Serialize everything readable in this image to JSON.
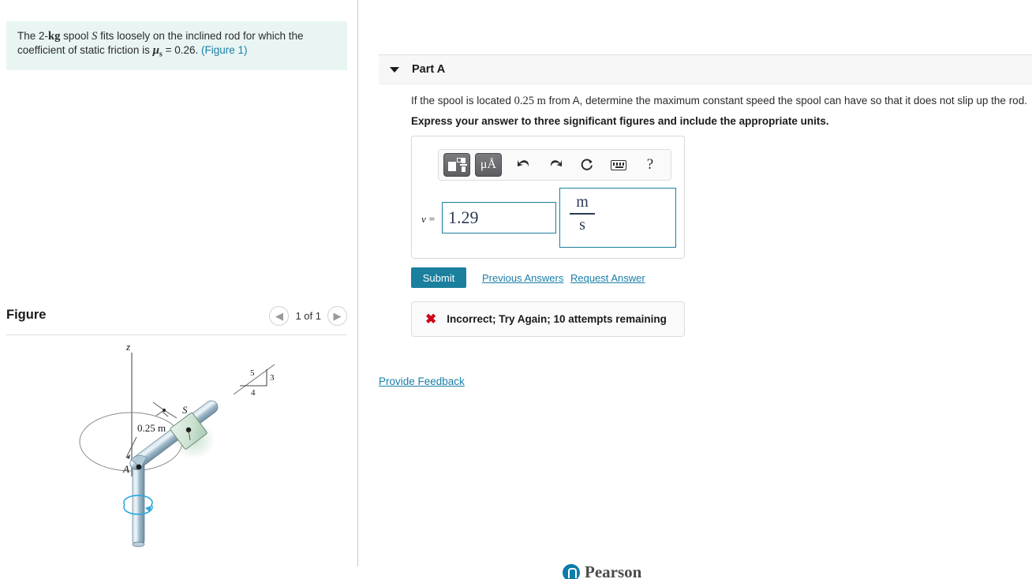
{
  "problem": {
    "line1_pre": "The 2-",
    "line1_kg": "kg",
    "line1_mid": " spool ",
    "line1_sym": "S",
    "line1_post": " fits loosely on the inclined rod for which the",
    "line2_pre": "coefficient of static friction is ",
    "line2_mu": "μ",
    "line2_sub": "s",
    "line2_post": " = 0.26. ",
    "figure_link": "(Figure 1)"
  },
  "figure": {
    "title": "Figure",
    "prev_icon": "chevron-left-icon",
    "next_icon": "chevron-right-icon",
    "counter": "1 of 1",
    "labels": {
      "axis_z": "z",
      "point_a": "A",
      "spool_s": "S",
      "dimension": "0.25 m",
      "slope_hyp": "5",
      "slope_vert": "3",
      "slope_horiz": "4"
    }
  },
  "part": {
    "caret_icon": "caret-down-icon",
    "title": "Part A",
    "question_pre": "If the spool is located ",
    "question_val": "0.25 m",
    "question_post": " from A, determine the maximum constant speed the spool can have so that it does not slip up the rod.",
    "instruction": "Express your answer to three significant figures and include the appropriate units."
  },
  "answer": {
    "toolbar": {
      "template_icon": "math-template-icon",
      "units_label": "μÅ",
      "undo_icon": "undo-arrow-icon",
      "redo_icon": "redo-arrow-icon",
      "reset_icon": "reset-circle-icon",
      "keyboard_icon": "keyboard-icon",
      "help_label": "?"
    },
    "variable": "v =",
    "value": "1.29",
    "unit_numerator": "m",
    "unit_denominator": "s"
  },
  "actions": {
    "submit_label": "Submit",
    "previous_answers": "Previous Answers",
    "request_answer": "Request Answer"
  },
  "feedback": {
    "status_icon": "x-mark-icon",
    "message": "Incorrect; Try Again; 10 attempts remaining",
    "accent_color": "#d0021b"
  },
  "provide_feedback": "Provide Feedback",
  "footer": {
    "brand": "Pearson",
    "logo_icon": "pearson-logo-icon"
  },
  "colors": {
    "accent": "#1b7f9e",
    "link": "#1a7fa8",
    "problem_bg": "#e8f5f3"
  }
}
